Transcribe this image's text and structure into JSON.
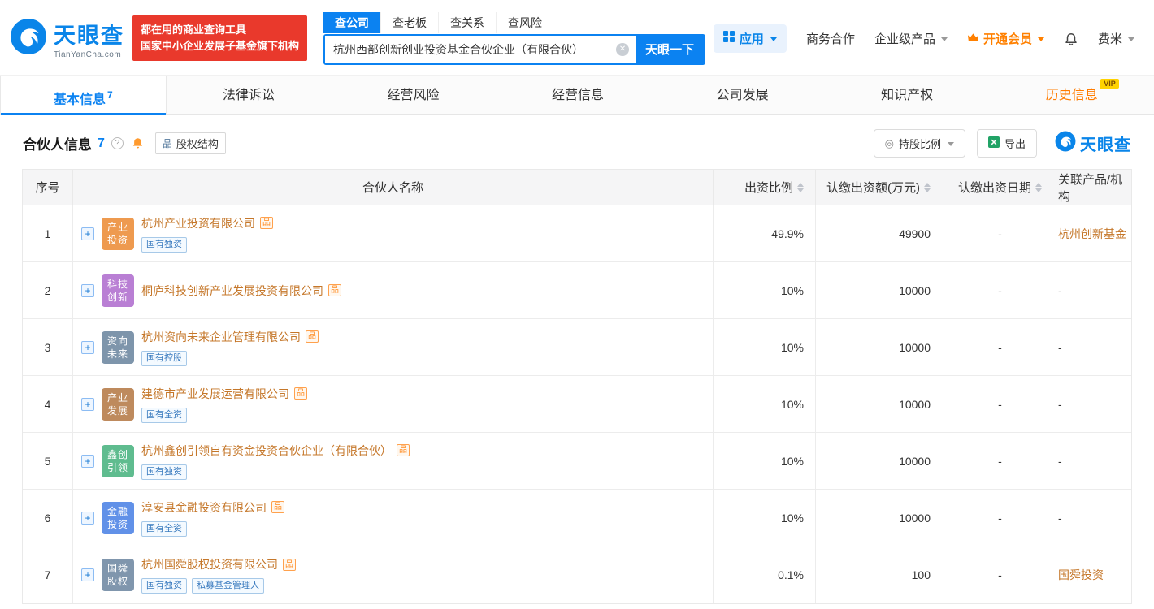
{
  "colors": {
    "brand_blue": "#0a85e9",
    "accent_red": "#e9392c",
    "link_orange": "#c5772a",
    "vip_orange": "#ff7c00",
    "member_orange": "#ff8000",
    "tag_blue": "#3a7bbf",
    "export_green": "#21a366"
  },
  "icons": {
    "org": "品",
    "plus": "+",
    "clear": "✕",
    "info": "?",
    "ratio": "◎"
  },
  "header": {
    "logo": {
      "brand": "天眼查",
      "domain": "TianYanCha.com"
    },
    "slogan": {
      "line1": "都在用的商业查询工具",
      "line2": "国家中小企业发展子基金旗下机构"
    },
    "search": {
      "tabs": [
        {
          "label": "查公司",
          "active": true
        },
        {
          "label": "查老板",
          "active": false
        },
        {
          "label": "查关系",
          "active": false
        },
        {
          "label": "查风险",
          "active": false
        }
      ],
      "value": "杭州西部创新创业投资基金合伙企业（有限合伙）",
      "button": "天眼一下"
    },
    "nav": {
      "apps": "应用",
      "cooperation": "商务合作",
      "enterprise": "企业级产品",
      "vip": "开通会员",
      "user": "费米"
    }
  },
  "tabs": [
    {
      "label": "基本信息",
      "count": "7"
    },
    {
      "label": "法律诉讼"
    },
    {
      "label": "经营风险"
    },
    {
      "label": "经营信息"
    },
    {
      "label": "公司发展"
    },
    {
      "label": "知识产权"
    },
    {
      "label": "历史信息",
      "vip_badge": "VIP"
    }
  ],
  "section": {
    "title": "合伙人信息",
    "count": "7",
    "equity_badge": "股权结构",
    "ratio_button": "持股比例",
    "export_button": "导出",
    "watermark": "天眼查"
  },
  "table": {
    "headers": [
      "序号",
      "合伙人名称",
      "出资比例",
      "认缴出资额(万元)",
      "认缴出资日期",
      "关联产品/机构"
    ],
    "rows": [
      {
        "no": "1",
        "avatar": {
          "line1": "产业",
          "line2": "投资",
          "color": "#ee9a4f"
        },
        "name": "杭州产业投资有限公司",
        "tags": [
          "国有独资"
        ],
        "ratio": "49.9%",
        "amount": "49900",
        "date": "-",
        "related": "杭州创新基金"
      },
      {
        "no": "2",
        "avatar": {
          "line1": "科技",
          "line2": "创新",
          "color": "#b97fd4"
        },
        "name": "桐庐科技创新产业发展投资有限公司",
        "tags": [],
        "ratio": "10%",
        "amount": "10000",
        "date": "-",
        "related": "-"
      },
      {
        "no": "3",
        "avatar": {
          "line1": "资向",
          "line2": "未来",
          "color": "#7e95ab"
        },
        "name": "杭州资向未来企业管理有限公司",
        "tags": [
          "国有控股"
        ],
        "ratio": "10%",
        "amount": "10000",
        "date": "-",
        "related": "-"
      },
      {
        "no": "4",
        "avatar": {
          "line1": "产业",
          "line2": "发展",
          "color": "#be8a5d"
        },
        "name": "建德市产业发展运营有限公司",
        "tags": [
          "国有全资"
        ],
        "ratio": "10%",
        "amount": "10000",
        "date": "-",
        "related": "-"
      },
      {
        "no": "5",
        "avatar": {
          "line1": "鑫创",
          "line2": "引领",
          "color": "#5fbc8f"
        },
        "name": "杭州鑫创引领自有资金投资合伙企业（有限合伙）",
        "tags": [
          "国有独资"
        ],
        "ratio": "10%",
        "amount": "10000",
        "date": "-",
        "related": "-"
      },
      {
        "no": "6",
        "avatar": {
          "line1": "金融",
          "line2": "投资",
          "color": "#6191e8"
        },
        "name": "淳安县金融投资有限公司",
        "tags": [
          "国有全资"
        ],
        "ratio": "10%",
        "amount": "10000",
        "date": "-",
        "related": "-"
      },
      {
        "no": "7",
        "avatar": {
          "line1": "国舜",
          "line2": "股权",
          "color": "#8096ad"
        },
        "name": "杭州国舜股权投资有限公司",
        "tags": [
          "国有独资",
          "私募基金管理人"
        ],
        "ratio": "0.1%",
        "amount": "100",
        "date": "-",
        "related": "国舜投资"
      }
    ]
  }
}
